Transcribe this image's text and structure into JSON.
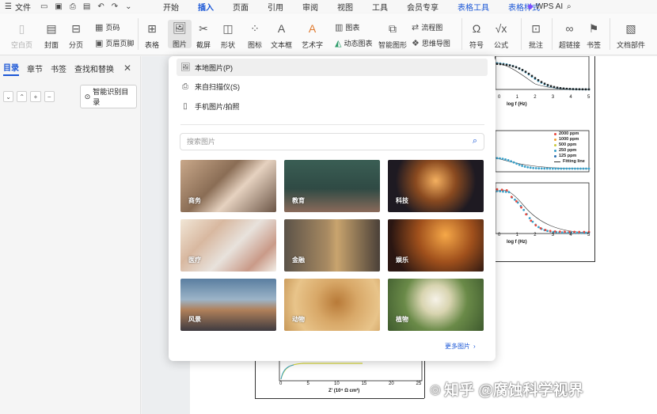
{
  "menubar": {
    "file_label": "文件",
    "tabs": [
      "开始",
      "插入",
      "页面",
      "引用",
      "审阅",
      "视图",
      "工具",
      "会员专享"
    ],
    "active_tab": "插入",
    "context_tabs": [
      "表格工具",
      "表格样式"
    ],
    "wps_ai": "WPS AI",
    "accent": "#1a56d6"
  },
  "ribbon": {
    "blank_page": "空白页",
    "cover": "封面",
    "section": "分页",
    "page_number": "页码",
    "header_footer": "页眉页脚",
    "table": "表格",
    "picture": "图片",
    "screenshot": "截屏",
    "shape": "形状",
    "icon": "图标",
    "textbox": "文本框",
    "wordart": "艺术字",
    "chart": "图表",
    "dynamic_chart": "动态图表",
    "smart_graphic": "智能图形",
    "flowchart": "流程图",
    "mindmap": "思维导图",
    "symbol": "符号",
    "formula": "公式",
    "comment": "批注",
    "hyperlink": "超链接",
    "bookmark": "书签",
    "doc_parts": "文档部件"
  },
  "leftpanel": {
    "tabs": [
      "目录",
      "章节",
      "书签",
      "查找和替换"
    ],
    "smart_toc": "智能识别目录"
  },
  "dropdown": {
    "items": [
      "本地图片(P)",
      "来自扫描仪(S)",
      "手机图片/拍照"
    ],
    "search_placeholder": "搜索图片",
    "categories": [
      "商务",
      "教育",
      "科技",
      "医疗",
      "金融",
      "娱乐",
      "风景",
      "动物",
      "植物"
    ],
    "more": "更多图片"
  },
  "doc": {
    "axis_logf_1": "log f (Hz)",
    "axis_logf_2": "log f (Hz)",
    "legend": [
      "2000 ppm",
      "1000 ppm",
      "500 ppm",
      "250 ppm",
      "125 ppm",
      "Fitting line"
    ],
    "legend_colors": [
      "#e8463c",
      "#f0a030",
      "#c9c93a",
      "#3aa0c9",
      "#2a6fb0",
      "#333333"
    ],
    "zaxis_label": "Z' (10⁴ Ω cm²)",
    "ticks_top": [
      "-1",
      "0",
      "1",
      "2",
      "3",
      "4",
      "5"
    ],
    "ticks_bottom": [
      "-1",
      "0",
      "1",
      "2",
      "3",
      "4",
      "5"
    ],
    "ticks_z": [
      "0",
      "5",
      "10",
      "15",
      "20",
      "25"
    ],
    "watermark": "知乎 @腐蚀科学视界"
  }
}
